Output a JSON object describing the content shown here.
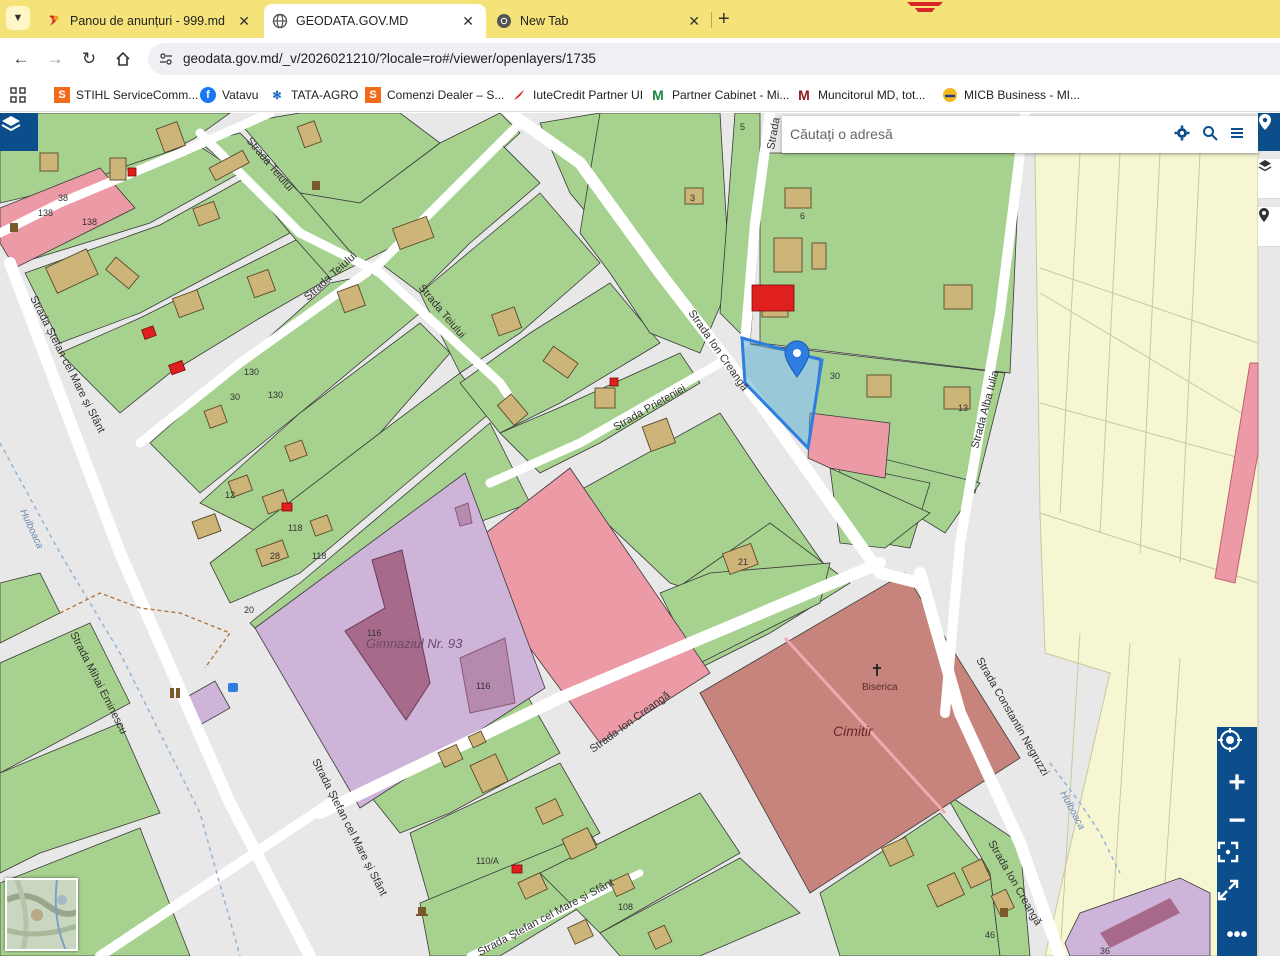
{
  "browser": {
    "tabs": [
      {
        "title": "Panou de anunțuri - 999.md",
        "active": false
      },
      {
        "title": "GEODATA.GOV.MD",
        "active": true
      },
      {
        "title": "New Tab",
        "active": false
      }
    ],
    "url": "geodata.gov.md/_v/2026021210/?locale=ro#/viewer/openlayers/1735",
    "bookmarks": [
      "STIHL ServiceComm...",
      "Vatavu",
      "TATA-AGRO",
      "Comenzi Dealer – S...",
      "IuteCredit Partner UI",
      "Partner Cabinet - Mi...",
      "Muncitorul MD, tot...",
      "MICB Business - MI..."
    ]
  },
  "search": {
    "placeholder": "Căutați o adresă"
  },
  "map": {
    "streets": {
      "teiului_a": "Strada Teiului",
      "teiului_b": "Strada Teiului",
      "teiului_c": "Strada Teiului",
      "stefan_a": "Strada Ștefan cel Mare și Sfânt",
      "stefan_b": "Strada Ștefan cel Mare și Sfânt",
      "stefan_c": "Strada Ștefan cel Mare și Sfânt",
      "creanga_a": "Strada Ion Creangă",
      "creanga_b": "Strada Ion Creangă",
      "creanga_c": "Strada Ion Creangă",
      "prieteniei": "Strada Prieteniei",
      "alba_iulia": "Strada Alba Iulia",
      "negruzzi": "Strada Constantin Negruzzi",
      "eminescu": "Strada Mihai Eminescu",
      "strada_top": "Strada",
      "river": "Hulboaca"
    },
    "places": {
      "school": "Gimnaziul Nr. 93",
      "church": "Biserica",
      "cemetery": "Cimitir"
    },
    "house_numbers": [
      "138",
      "138",
      "38",
      "130",
      "130",
      "30",
      "118",
      "118",
      "116",
      "116",
      "110/A",
      "108",
      "30",
      "6",
      "3",
      "5",
      "20",
      "28",
      "12",
      "21",
      "13",
      "36",
      "46"
    ],
    "colors": {
      "parcel_green": "#a6d18f",
      "parcel_pink": "#eb9aa6",
      "parcel_purple": "#cdb4d8",
      "cemetery": "#c7847c",
      "field_yellow": "#f5f5d0",
      "building": "#cdb478",
      "selected_parcel": "#2e7de0",
      "brand_blue": "#0c4d8c"
    }
  },
  "controls": {
    "locate": "locate-icon",
    "zoom_in": "+",
    "zoom_out": "−",
    "fullscreen": "fullscreen-icon",
    "extent": "expand-icon",
    "more": "more-icon"
  }
}
